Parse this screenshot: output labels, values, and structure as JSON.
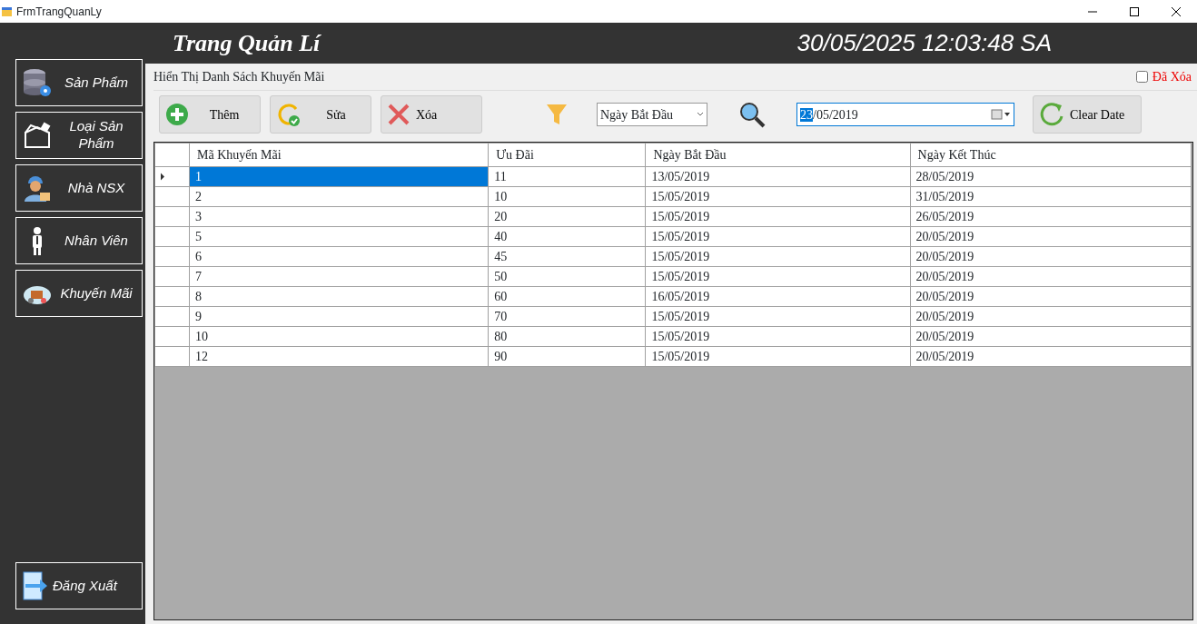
{
  "window": {
    "title": "FrmTrangQuanLy"
  },
  "header": {
    "title": "Trang Quản Lí",
    "datetime": "30/05/2025 12:03:48 SA"
  },
  "sidebar": {
    "items": [
      {
        "label": "Sản Phẩm",
        "kind": "database"
      },
      {
        "label": "Loại  Sản Phẩm",
        "kind": "box"
      },
      {
        "label": "Nhà NSX",
        "kind": "worker"
      },
      {
        "label": "Nhân Viên",
        "kind": "person"
      },
      {
        "label": "Khuyến Mãi",
        "kind": "cloud"
      }
    ],
    "logout": {
      "label": "Đăng Xuất"
    }
  },
  "section_title": "Hiển Thị Danh Sách Khuyến Mãi",
  "deleted_checkbox": {
    "label": "Đã Xóa",
    "checked": false
  },
  "toolbar": {
    "buttons": [
      {
        "label": "Thêm",
        "kind": "add"
      },
      {
        "label": "Sửa",
        "kind": "edit"
      },
      {
        "label": "Xóa",
        "kind": "delete"
      }
    ],
    "filter_select": {
      "value": "Ngày Bắt Đầu"
    },
    "date_field": {
      "highlighted": "23",
      "rest": "/05/2019"
    },
    "clear_button": {
      "label": "Clear Date"
    }
  },
  "table": {
    "columns": [
      "Mã Khuyến Mãi",
      "Ưu Đãi",
      "Ngày Bắt Đầu",
      "Ngày Kết Thúc"
    ],
    "rows": [
      {
        "cells": [
          "1",
          "11",
          "13/05/2019",
          "28/05/2019"
        ],
        "selected": true
      },
      {
        "cells": [
          "2",
          "10",
          "15/05/2019",
          "31/05/2019"
        ],
        "selected": false
      },
      {
        "cells": [
          "3",
          "20",
          "15/05/2019",
          "26/05/2019"
        ],
        "selected": false
      },
      {
        "cells": [
          "5",
          "40",
          "15/05/2019",
          "20/05/2019"
        ],
        "selected": false
      },
      {
        "cells": [
          "6",
          "45",
          "15/05/2019",
          "20/05/2019"
        ],
        "selected": false
      },
      {
        "cells": [
          "7",
          "50",
          "15/05/2019",
          "20/05/2019"
        ],
        "selected": false
      },
      {
        "cells": [
          "8",
          "60",
          "16/05/2019",
          "20/05/2019"
        ],
        "selected": false
      },
      {
        "cells": [
          "9",
          "70",
          "15/05/2019",
          "20/05/2019"
        ],
        "selected": false
      },
      {
        "cells": [
          "10",
          "80",
          "15/05/2019",
          "20/05/2019"
        ],
        "selected": false
      },
      {
        "cells": [
          "12",
          "90",
          "15/05/2019",
          "20/05/2019"
        ],
        "selected": false
      }
    ]
  }
}
